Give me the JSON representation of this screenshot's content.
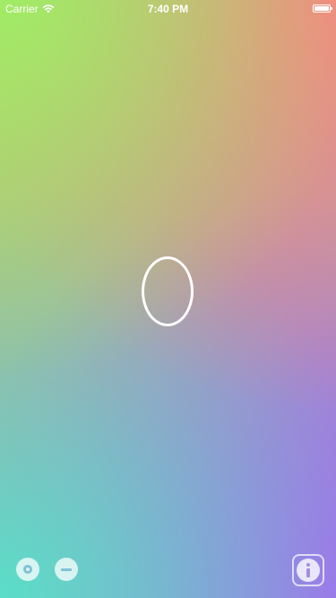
{
  "status_bar": {
    "carrier": "Carrier",
    "time": "7:40 PM",
    "icons": [
      "wifi-icon",
      "battery-icon"
    ]
  },
  "counter": {
    "value": "0"
  },
  "controls": {
    "reset_icon": "reset-icon",
    "decrement_icon": "minus-icon",
    "info_icon": "info-icon"
  },
  "colors": {
    "top_left": "#a0ec66",
    "top_right": "#fa8282",
    "bottom_left": "#5adec8",
    "bottom_right": "#aa64f0",
    "foreground": "#ffffff"
  }
}
